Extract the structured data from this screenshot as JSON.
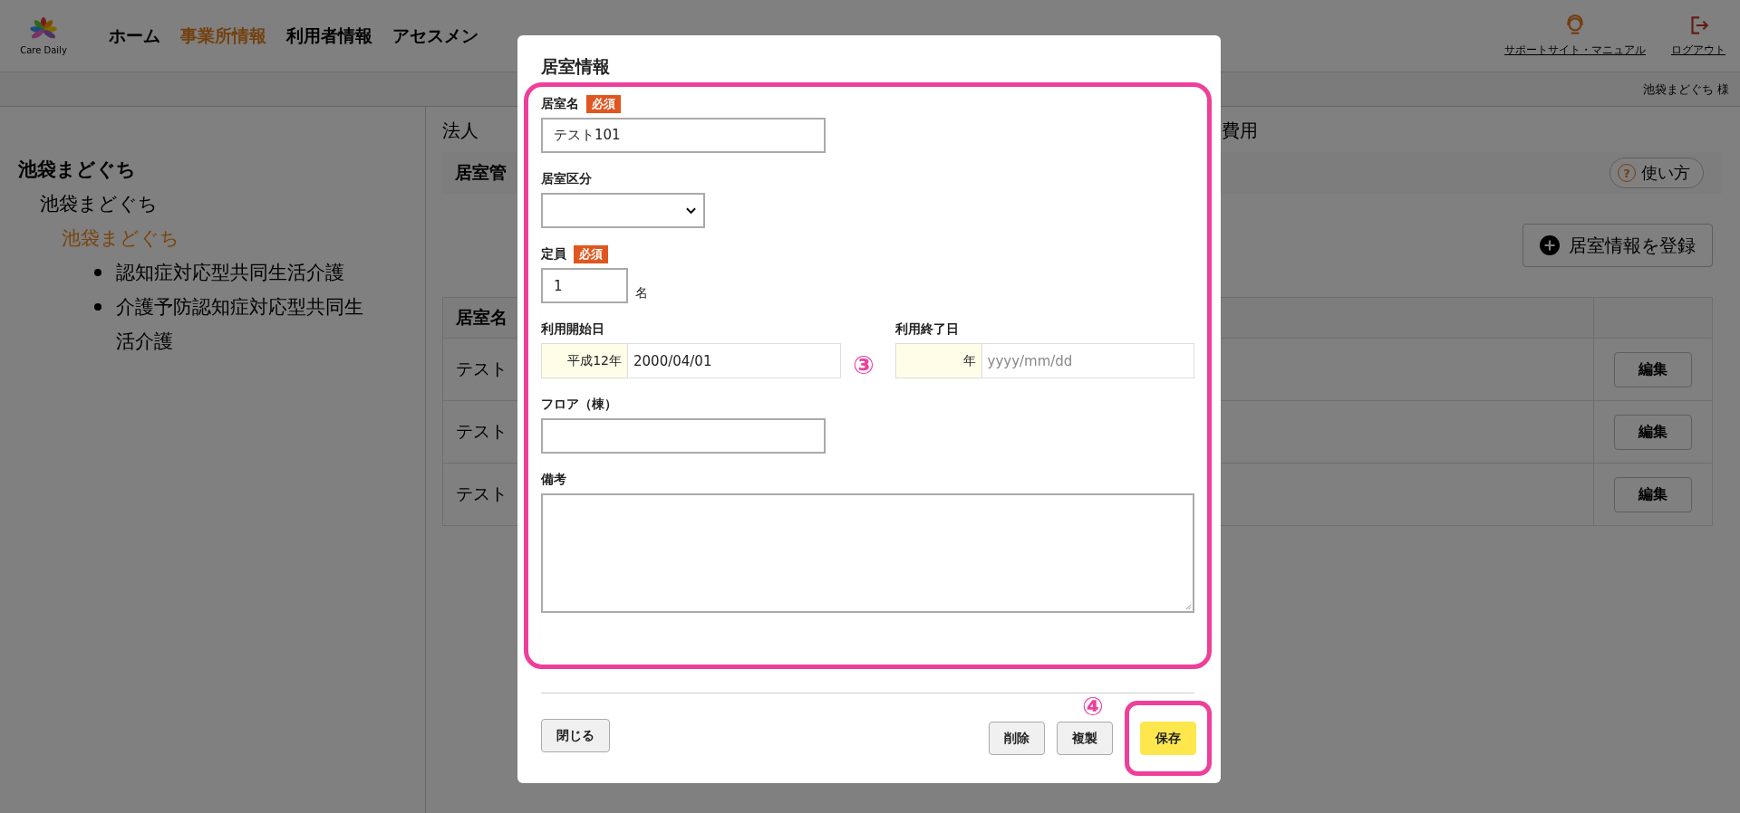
{
  "header": {
    "logo_text": "Care Daily",
    "nav": [
      {
        "label": "ホーム",
        "selected": false
      },
      {
        "label": "事業所情報",
        "selected": true
      },
      {
        "label": "利用者情報",
        "selected": false
      },
      {
        "label": "アセスメン",
        "selected": false
      }
    ],
    "support_link": "サポートサイト・マニュアル",
    "logout_link": "ログアウト",
    "user": "池袋まどぐち 様"
  },
  "sidebar": {
    "tree": [
      {
        "label": "池袋まどぐち",
        "selected": false,
        "children": [
          {
            "label": "池袋まどぐち",
            "selected": false,
            "children": [
              {
                "label": "池袋まどぐち",
                "selected": true,
                "children": [
                  {
                    "label": "認知症対応型共同生活介護",
                    "selected": false
                  },
                  {
                    "label": "介護予防認知症対応型共同生活介護",
                    "selected": false
                  }
                ]
              }
            ]
          }
        ]
      }
    ]
  },
  "main": {
    "tabs": [
      {
        "label": "法人",
        "selected": false
      },
      {
        "label": "費用",
        "selected": false
      }
    ],
    "section_title": "居室管",
    "help_icon": "?",
    "help_button": "使い方",
    "register_button": "居室情報を登録",
    "table": {
      "header": "居室名",
      "rows": [
        {
          "name": "テスト",
          "action": "編集"
        },
        {
          "name": "テスト",
          "action": "編集"
        },
        {
          "name": "テスト",
          "action": "編集"
        }
      ]
    }
  },
  "modal": {
    "title": "居室情報",
    "fields": [
      {
        "kind": "text",
        "label": "居室名",
        "required_badge": "必須",
        "value": "テスト101"
      },
      {
        "kind": "select",
        "label": "居室区分"
      },
      {
        "kind": "unit",
        "label": "定員",
        "required_badge": "必須",
        "value": "1",
        "unit": "名"
      },
      {
        "kind": "dates",
        "items": [
          {
            "label": "利用開始日",
            "era": "平成12年",
            "value": "2000/04/01"
          },
          {
            "label": "利用終了日",
            "era": "年",
            "placeholder": "yyyy/mm/dd"
          }
        ]
      },
      {
        "kind": "text",
        "label": "フロア（棟）"
      },
      {
        "kind": "textarea",
        "label": "備考"
      }
    ],
    "left_buttons": [
      {
        "label": "閉じる",
        "kind": "plain"
      }
    ],
    "right_buttons": [
      {
        "label": "削除",
        "kind": "plain"
      },
      {
        "label": "複製",
        "kind": "plain"
      },
      {
        "label": "保存",
        "kind": "primary"
      }
    ],
    "callouts": [
      {
        "label": "③"
      },
      {
        "label": "④"
      }
    ]
  }
}
